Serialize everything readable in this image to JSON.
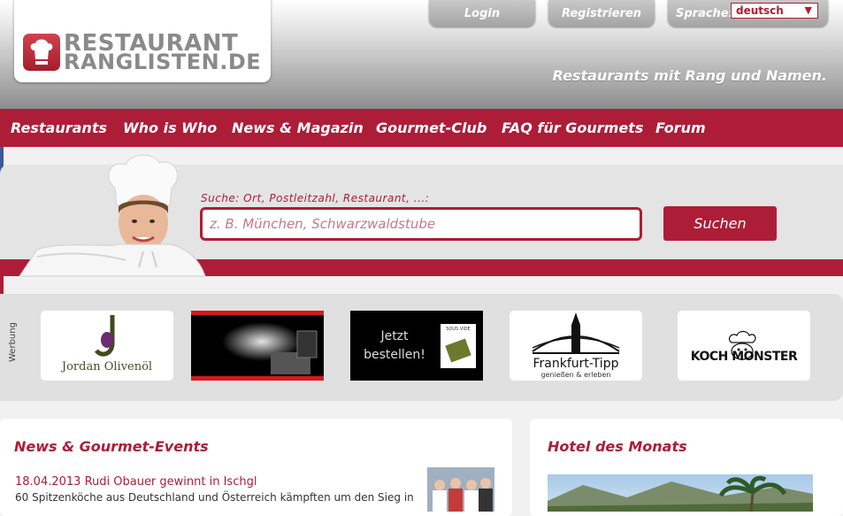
{
  "logo": {
    "line1": "RESTAURANT",
    "line2": "RANGLISTEN.DE"
  },
  "header": {
    "login_label": "Login",
    "register_label": "Registrieren",
    "language_label": "Sprache:",
    "language_value": "deutsch",
    "tagline": "Restaurants mit Rang und Namen."
  },
  "nav": {
    "items": [
      "Restaurants",
      "Who is Who",
      "News & Magazin",
      "Gourmet-Club",
      "FAQ für Gourmets",
      "Forum"
    ]
  },
  "search": {
    "label": "Suche: Ort, Postleitzahl, Restaurant, ...:",
    "placeholder": "z. B. München, Schwarzwaldstube",
    "button_label": "Suchen"
  },
  "ads": {
    "section_label": "Werbung",
    "jordan": "Jordan Olivenöl",
    "jetzt_line1": "Jetzt",
    "jetzt_line2": "bestellen!",
    "jetzt_badge": "SOUS VIDE",
    "frankfurt_name": "Frankfurt-Tipp",
    "frankfurt_sub": "genießen & erleben",
    "kochmonster": "KOCH MONSTER"
  },
  "news": {
    "title": "News & Gourmet-Events",
    "headline": "18.04.2013 Rudi Obauer gewinnt in Ischgl",
    "text": "60 Spitzenköche aus Deutschland und Österreich kämpften um den Sieg in"
  },
  "hotel": {
    "title": "Hotel des Monats"
  },
  "colors": {
    "brand_red": "#ad1d38",
    "header_gray": "#a8a8a8"
  }
}
